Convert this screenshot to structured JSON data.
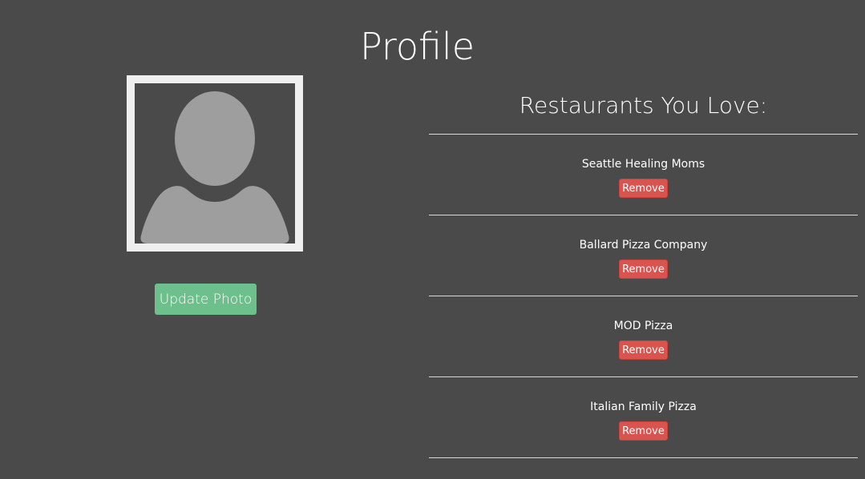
{
  "page": {
    "title": "Profile"
  },
  "profile_photo": {
    "icon": "person-placeholder-icon",
    "update_button_label": "Update Photo"
  },
  "favorites": {
    "heading": "Restaurants You Love:",
    "remove_label": "Remove",
    "items": [
      {
        "name": "Seattle Healing Moms"
      },
      {
        "name": "Ballard Pizza Company"
      },
      {
        "name": "MOD Pizza"
      },
      {
        "name": "Italian Family Pizza"
      }
    ]
  },
  "colors": {
    "background": "#4a4a4a",
    "update_button": "#6dbf8b",
    "remove_button": "#d9534f",
    "avatar_frame": "#efefef",
    "avatar_silhouette": "#9e9e9e"
  }
}
